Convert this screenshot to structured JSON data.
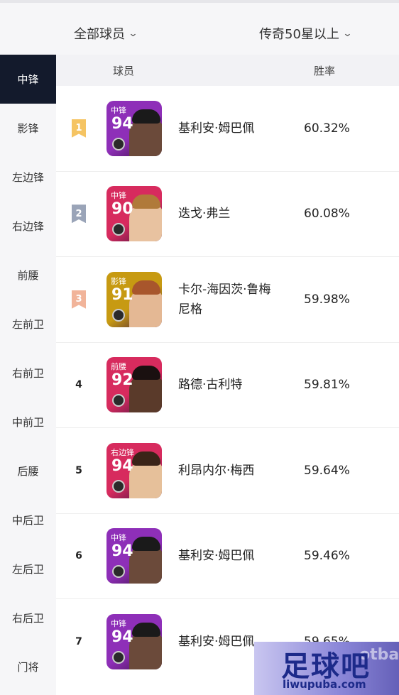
{
  "filters": {
    "scope_label": "全部球员",
    "tier_label": "传奇50星以上"
  },
  "sidebar": {
    "items": [
      {
        "label": "中锋",
        "active": true
      },
      {
        "label": "影锋",
        "active": false
      },
      {
        "label": "左边锋",
        "active": false
      },
      {
        "label": "右边锋",
        "active": false
      },
      {
        "label": "前腰",
        "active": false
      },
      {
        "label": "左前卫",
        "active": false
      },
      {
        "label": "右前卫",
        "active": false
      },
      {
        "label": "中前卫",
        "active": false
      },
      {
        "label": "后腰",
        "active": false
      },
      {
        "label": "中后卫",
        "active": false
      },
      {
        "label": "左后卫",
        "active": false
      },
      {
        "label": "右后卫",
        "active": false
      },
      {
        "label": "门将",
        "active": false
      }
    ]
  },
  "table": {
    "headers": {
      "player": "球员",
      "win_rate": "胜率"
    },
    "rows": [
      {
        "rank": "1",
        "position": "中锋",
        "rating": "94",
        "name": "基利安·姆巴佩",
        "win_rate": "60.32%",
        "rank_color": "#f5c463",
        "card_color": "#8e2fb8"
      },
      {
        "rank": "2",
        "position": "中锋",
        "rating": "90",
        "name": "迭戈·弗兰",
        "win_rate": "60.08%",
        "rank_color": "#9aa4b8",
        "card_color": "#d72b5e"
      },
      {
        "rank": "3",
        "position": "影锋",
        "rating": "91",
        "name": "卡尔-海因茨·鲁梅尼格",
        "win_rate": "59.98%",
        "rank_color": "#f1b49a",
        "card_color": "#c79a12"
      },
      {
        "rank": "4",
        "position": "前腰",
        "rating": "92",
        "name": "路德·古利特",
        "win_rate": "59.81%",
        "rank_color": "",
        "card_color": "#d72b5e"
      },
      {
        "rank": "5",
        "position": "右边锋",
        "rating": "94",
        "name": "利昂内尔·梅西",
        "win_rate": "59.64%",
        "rank_color": "",
        "card_color": "#d72b5e"
      },
      {
        "rank": "6",
        "position": "中锋",
        "rating": "94",
        "name": "基利安·姆巴佩",
        "win_rate": "59.46%",
        "rank_color": "",
        "card_color": "#8e2fb8"
      },
      {
        "rank": "7",
        "position": "中锋",
        "rating": "94",
        "name": "基利安·姆巴佩",
        "win_rate": "59.65%",
        "rank_color": "",
        "card_color": "#8e2fb8"
      }
    ]
  },
  "watermark": {
    "title": "足球吧",
    "url": "liwupuba.com",
    "background_text": "otba"
  },
  "icons": {
    "dropdown": "chevron-down-icon",
    "card_badge": "club-badge-icon",
    "rank_marker": "ribbon-icon"
  }
}
